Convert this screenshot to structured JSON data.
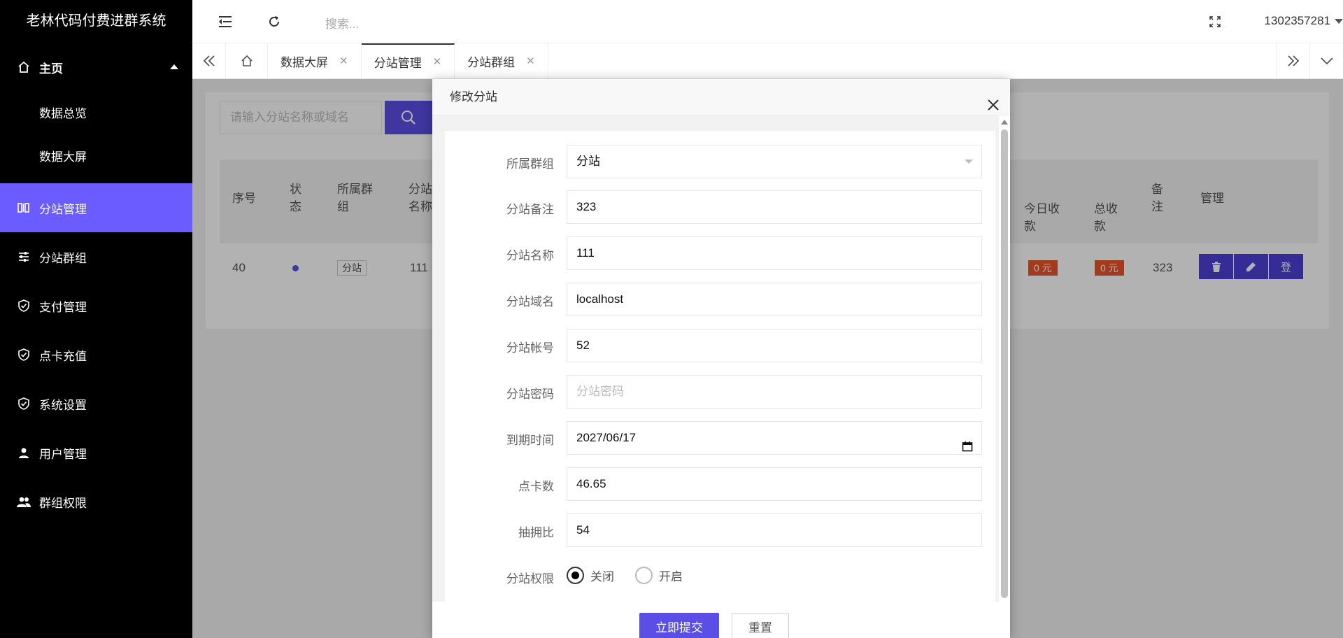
{
  "app": {
    "title": "老林代码付费进群系统"
  },
  "sidebar": {
    "home": {
      "label": "主页"
    },
    "sub_items": [
      {
        "label": "数据总览"
      },
      {
        "label": "数据大屏"
      }
    ],
    "items": [
      {
        "label": "分站管理",
        "icon": "columns-icon",
        "active": true
      },
      {
        "label": "分站群组",
        "icon": "sliders-icon"
      },
      {
        "label": "支付管理",
        "icon": "shield-check-icon"
      },
      {
        "label": "点卡充值",
        "icon": "shield-check-icon"
      },
      {
        "label": "系统设置",
        "icon": "shield-check-icon"
      },
      {
        "label": "用户管理",
        "icon": "user-icon"
      },
      {
        "label": "群组权限",
        "icon": "users-icon"
      }
    ]
  },
  "header": {
    "search_placeholder": "搜索...",
    "user": "1302357281"
  },
  "tabs": [
    {
      "label": "数据大屏",
      "active": false
    },
    {
      "label": "分站管理",
      "active": true
    },
    {
      "label": "分站群组",
      "active": false
    }
  ],
  "list": {
    "search_placeholder": "请输入分站名称或域名",
    "columns": {
      "id": "序号",
      "status": "状态",
      "group": "所属群组",
      "name": "分站名称",
      "today_income": "今日收款",
      "total_income": "总收款",
      "remark": "备注",
      "manage": "管理"
    },
    "row": {
      "id": "40",
      "group": "分站",
      "name": "111",
      "today_income": "0 元",
      "total_income": "0 元",
      "remark": "323",
      "ops": [
        "trash-icon",
        "edit-icon",
        "登"
      ]
    }
  },
  "modal": {
    "title": "修改分站",
    "fields": {
      "group": {
        "label": "所属群组",
        "value": "分站"
      },
      "remark": {
        "label": "分站备注",
        "value": "323"
      },
      "name": {
        "label": "分站名称",
        "value": "111"
      },
      "domain": {
        "label": "分站域名",
        "value": "localhost"
      },
      "account": {
        "label": "分站帐号",
        "value": "52"
      },
      "password": {
        "label": "分站密码",
        "placeholder": "分站密码"
      },
      "expire": {
        "label": "到期时间",
        "value": "2027/06/17"
      },
      "points": {
        "label": "点卡数",
        "value": "46.65"
      },
      "commission": {
        "label": "抽拥比",
        "value": "54"
      },
      "permission": {
        "label": "分站权限",
        "options": [
          "关闭",
          "开启"
        ],
        "selected": "关闭"
      }
    },
    "submit": "立即提交",
    "reset": "重置"
  }
}
